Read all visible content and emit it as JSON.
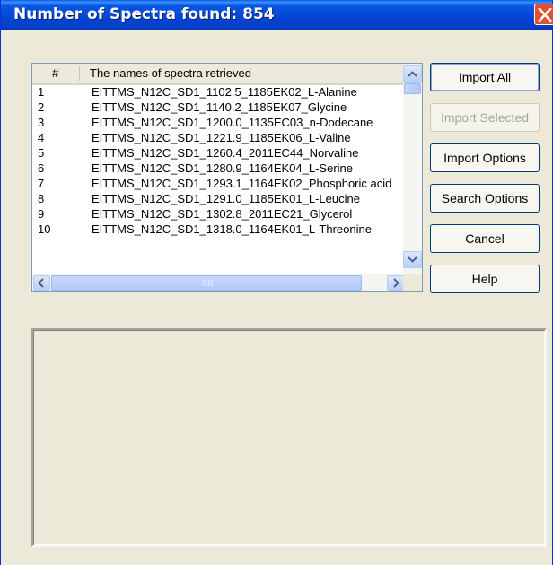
{
  "window": {
    "title": "Number of Spectra found: 854"
  },
  "list": {
    "columns": [
      "#",
      "The names of spectra retrieved"
    ],
    "rows": [
      {
        "num": "1",
        "name": "EITTMS_N12C_SD1_1102.5_1185EK02_L-Alanine"
      },
      {
        "num": "2",
        "name": "EITTMS_N12C_SD1_1140.2_1185EK07_Glycine"
      },
      {
        "num": "3",
        "name": "EITTMS_N12C_SD1_1200.0_1135EC03_n-Dodecane"
      },
      {
        "num": "4",
        "name": "EITTMS_N12C_SD1_1221.9_1185EK06_L-Valine"
      },
      {
        "num": "5",
        "name": "EITTMS_N12C_SD1_1260.4_2011EC44_Norvaline"
      },
      {
        "num": "6",
        "name": "EITTMS_N12C_SD1_1280.9_1164EK04_L-Serine"
      },
      {
        "num": "7",
        "name": "EITTMS_N12C_SD1_1293.1_1164EK02_Phosphoric acid"
      },
      {
        "num": "8",
        "name": "EITTMS_N12C_SD1_1291.0_1185EK01_L-Leucine"
      },
      {
        "num": "9",
        "name": "EITTMS_N12C_SD1_1302.8_2011EC21_Glycerol"
      },
      {
        "num": "10",
        "name": "EITTMS_N12C_SD1_1318.0_1164EK01_L-Threonine"
      }
    ]
  },
  "buttons": {
    "import_all": "Import All",
    "import_selected": "Import Selected",
    "import_options": "Import Options",
    "search_options": "Search Options",
    "cancel": "Cancel",
    "help": "Help"
  }
}
